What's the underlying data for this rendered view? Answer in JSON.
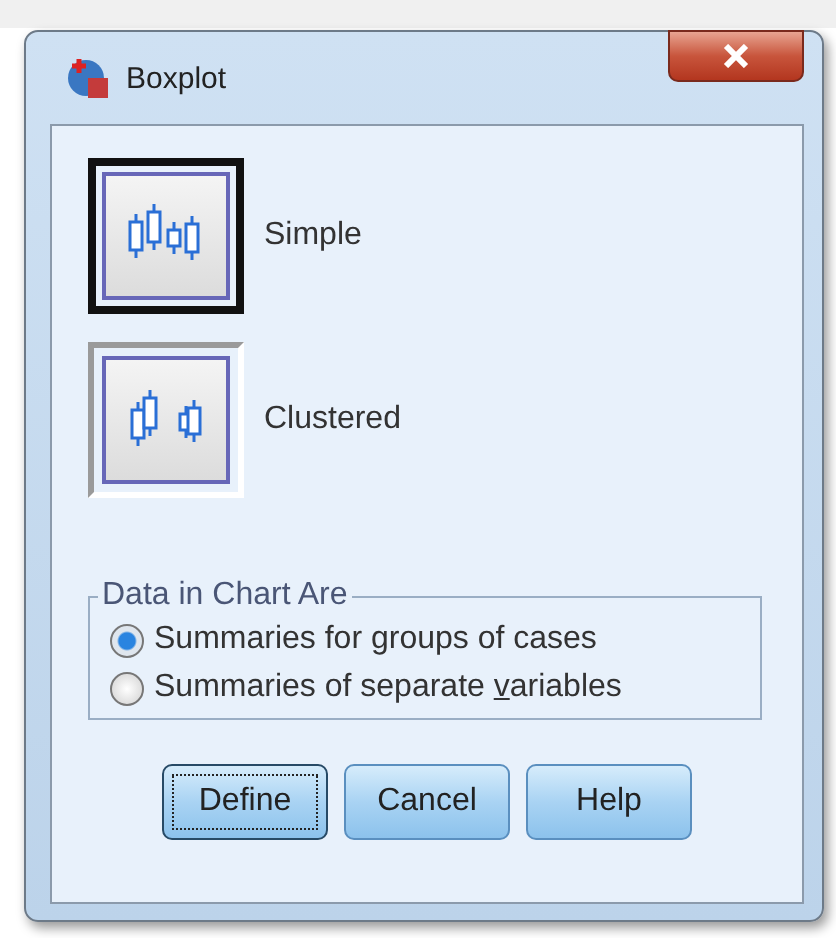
{
  "window": {
    "title": "Boxplot"
  },
  "chart_types": [
    {
      "label": "Simple",
      "kind": "simple",
      "selected": true
    },
    {
      "label": "Clustered",
      "kind": "clustered",
      "selected": false
    }
  ],
  "data_group": {
    "title": "Data in Chart Are",
    "options": [
      {
        "label_start": "Summaries for ",
        "access_key": "g",
        "label_end": "roups of cases",
        "selected": true
      },
      {
        "label_start": "Summaries of separate ",
        "access_key": "v",
        "label_end": "ariables",
        "selected": false
      }
    ]
  },
  "buttons": [
    {
      "label": "Define",
      "focused": true
    },
    {
      "label": "Cancel",
      "focused": false
    },
    {
      "label": "Help",
      "focused": false
    }
  ]
}
